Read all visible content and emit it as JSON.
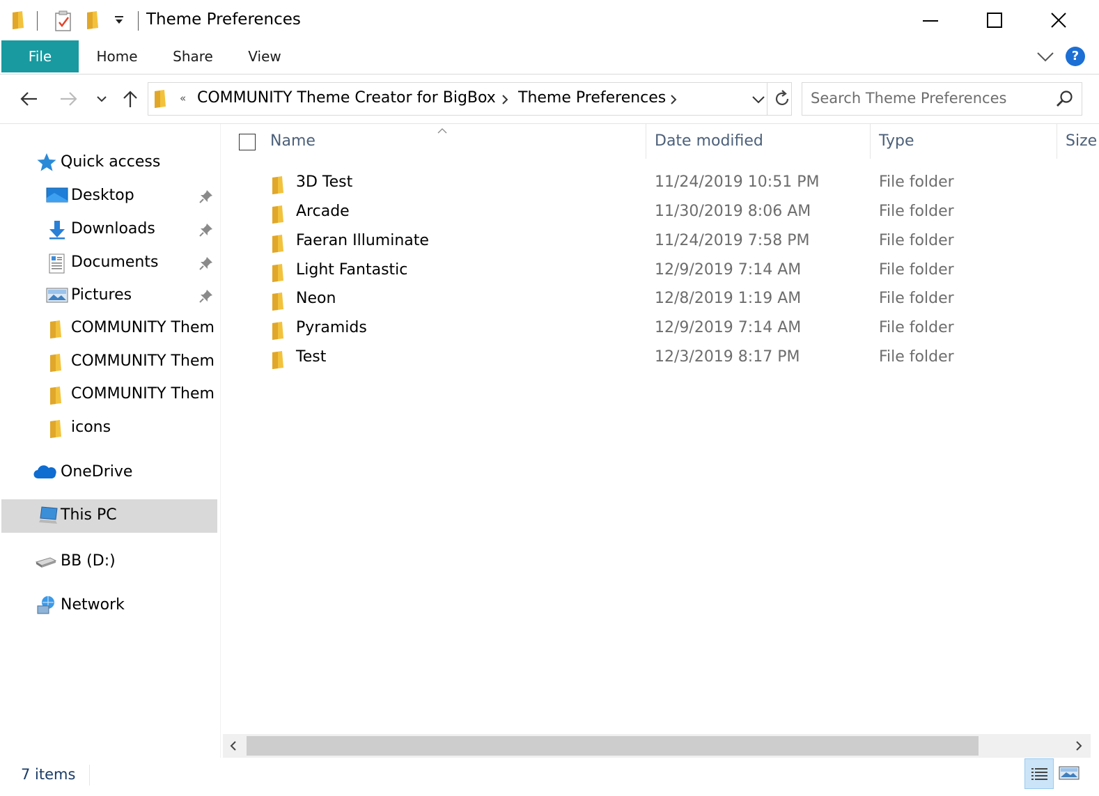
{
  "window": {
    "title": "Theme Preferences",
    "accent": "#189aa0"
  },
  "ribbon": {
    "tabs": [
      {
        "label": "File",
        "active": true
      },
      {
        "label": "Home"
      },
      {
        "label": "Share"
      },
      {
        "label": "View"
      }
    ],
    "help_label": "?"
  },
  "address": {
    "overflow_label": "«",
    "crumbs": [
      "COMMUNITY Theme Creator for BigBox",
      "Theme Preferences"
    ],
    "search_placeholder": "Search Theme Preferences"
  },
  "sidebar": {
    "quick_access": "Quick access",
    "quick_items": [
      {
        "label": "Desktop",
        "icon": "desktop-icon",
        "pinned": true
      },
      {
        "label": "Downloads",
        "icon": "downloads-icon",
        "pinned": true
      },
      {
        "label": "Documents",
        "icon": "documents-icon",
        "pinned": true
      },
      {
        "label": "Pictures",
        "icon": "pictures-icon",
        "pinned": true
      },
      {
        "label": "COMMUNITY Them",
        "icon": "folder-icon"
      },
      {
        "label": "COMMUNITY Them",
        "icon": "folder-icon"
      },
      {
        "label": "COMMUNITY Them",
        "icon": "folder-icon"
      },
      {
        "label": "icons",
        "icon": "folder-icon"
      }
    ],
    "onedrive": "OneDrive",
    "this_pc": "This PC",
    "drive": "BB (D:)",
    "network": "Network"
  },
  "columns": {
    "name": "Name",
    "date": "Date modified",
    "type": "Type",
    "size": "Size"
  },
  "files": [
    {
      "name": "3D Test",
      "date": "11/24/2019 10:51 PM",
      "type": "File folder"
    },
    {
      "name": "Arcade",
      "date": "11/30/2019 8:06 AM",
      "type": "File folder"
    },
    {
      "name": "Faeran Illuminate",
      "date": "11/24/2019 7:58 PM",
      "type": "File folder"
    },
    {
      "name": "Light Fantastic",
      "date": "12/9/2019 7:14 AM",
      "type": "File folder"
    },
    {
      "name": "Neon",
      "date": "12/8/2019 1:19 AM",
      "type": "File folder"
    },
    {
      "name": "Pyramids",
      "date": "12/9/2019 7:14 AM",
      "type": "File folder"
    },
    {
      "name": "Test",
      "date": "12/3/2019 8:17 PM",
      "type": "File folder"
    }
  ],
  "status": {
    "count": "7 items"
  }
}
